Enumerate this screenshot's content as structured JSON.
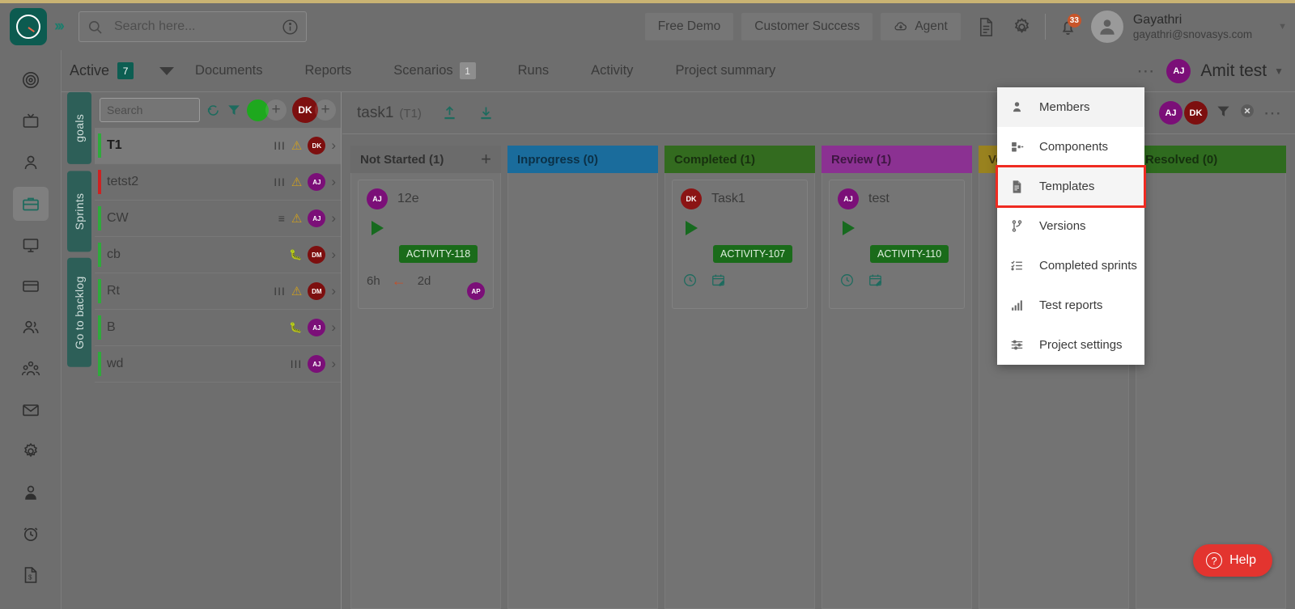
{
  "header": {
    "logo_icon": "speedometer-logo-icon",
    "expand_icon": "chevron-double-right-icon",
    "search": {
      "placeholder": "Search here...",
      "value": "",
      "icon": "search-icon",
      "info_icon": "info-circle-icon"
    },
    "buttons": [
      {
        "label": "Free Demo",
        "name": "free-demo-button"
      },
      {
        "label": "Customer Success",
        "name": "customer-success-button"
      },
      {
        "label": "Agent",
        "name": "agent-button",
        "icon": "cloud-download-icon"
      }
    ],
    "doc_icon": "document-icon",
    "settings_icon": "gear-icon",
    "notification_icon": "bell-icon",
    "notification_count": "33",
    "user": {
      "name": "Gayathri",
      "email": "gayathri@snovasys.com",
      "avatar_icon": "user-avatar-icon"
    },
    "user_caret_icon": "chevron-down-icon"
  },
  "rail": {
    "items": [
      {
        "name": "sidebar-item-goals",
        "icon": "target-icon"
      },
      {
        "name": "sidebar-item-presentation",
        "icon": "tv-icon"
      },
      {
        "name": "sidebar-item-profile",
        "icon": "person-icon"
      },
      {
        "name": "sidebar-item-projects",
        "icon": "briefcase-icon",
        "active": true
      },
      {
        "name": "sidebar-item-desktop",
        "icon": "monitor-icon"
      },
      {
        "name": "sidebar-item-billing",
        "icon": "card-icon"
      },
      {
        "name": "sidebar-item-teams",
        "icon": "people-icon"
      },
      {
        "name": "sidebar-item-organization",
        "icon": "group-icon"
      },
      {
        "name": "sidebar-item-mail",
        "icon": "envelope-icon"
      },
      {
        "name": "sidebar-item-settings",
        "icon": "gear-icon"
      },
      {
        "name": "sidebar-item-user",
        "icon": "user-circle-icon"
      },
      {
        "name": "sidebar-item-timesheet",
        "icon": "alarm-clock-icon"
      },
      {
        "name": "sidebar-item-invoice",
        "icon": "invoice-icon"
      }
    ]
  },
  "tabbar": {
    "active_filter": {
      "label": "Active",
      "count": "7"
    },
    "dropdown_icon": "triangle-down-icon",
    "tabs": [
      {
        "label": "Documents",
        "count": ""
      },
      {
        "label": "Reports",
        "count": ""
      },
      {
        "label": "Scenarios",
        "count": "1"
      },
      {
        "label": "Runs",
        "count": ""
      },
      {
        "label": "Activity",
        "count": ""
      },
      {
        "label": "Project summary",
        "count": ""
      }
    ],
    "more_icon": "ellipsis-icon",
    "project": {
      "initials": "AJ",
      "name": "Amit test",
      "color": "#7b0f78"
    },
    "project_caret_icon": "chevron-down-icon"
  },
  "vertical_tabs": [
    {
      "label": "goals",
      "icon": "pin-icon"
    },
    {
      "label": "Sprints",
      "icon": "pin-icon"
    },
    {
      "label": "Go to backlog",
      "icon": "arrow-up-icon"
    }
  ],
  "list_panel": {
    "search_placeholder": "Search",
    "search_value": "",
    "refresh_icon": "refresh-icon",
    "filter_icon": "filter-icon",
    "status_dot_color": "#1ea81e",
    "add_icon": "plus-icon",
    "owner_avatar": {
      "initials": "DK",
      "color": "#7d0f0f"
    },
    "add_member_icon": "plus-icon",
    "rows": [
      {
        "name": "T1",
        "bar": "#2faa3c",
        "selected": true,
        "priority": "III",
        "warn": true,
        "bug": false,
        "avatar": {
          "initials": "DK",
          "color": "#7d0f0f"
        }
      },
      {
        "name": "tetst2",
        "bar": "#cc2222",
        "selected": false,
        "priority": "III",
        "warn": true,
        "bug": false,
        "avatar": {
          "initials": "AJ",
          "color": "#7b0f78"
        }
      },
      {
        "name": "CW",
        "bar": "#2faa3c",
        "selected": false,
        "priority": "≡",
        "warn": true,
        "bug": false,
        "avatar": {
          "initials": "AJ",
          "color": "#7b0f78"
        }
      },
      {
        "name": "cb",
        "bar": "#2faa3c",
        "selected": false,
        "priority": "",
        "warn": false,
        "bug": true,
        "avatar": {
          "initials": "DM",
          "color": "#7d0f0f"
        }
      },
      {
        "name": "Rt",
        "bar": "#2faa3c",
        "selected": false,
        "priority": "III",
        "warn": true,
        "bug": false,
        "avatar": {
          "initials": "DM",
          "color": "#7d0f0f"
        }
      },
      {
        "name": "B",
        "bar": "#2faa3c",
        "selected": false,
        "priority": "",
        "warn": false,
        "bug": true,
        "avatar": {
          "initials": "AJ",
          "color": "#7b0f78"
        }
      },
      {
        "name": "wd",
        "bar": "#2faa3c",
        "selected": false,
        "priority": "III",
        "warn": false,
        "bug": false,
        "avatar": {
          "initials": "AJ",
          "color": "#7b0f78"
        }
      }
    ]
  },
  "board": {
    "title": "task1",
    "title_key": "(T1)",
    "upload_icon": "upload-icon",
    "download_icon": "download-icon",
    "toolbar_avatars": [
      {
        "initials": "AJ",
        "color": "#7b0f78"
      },
      {
        "initials": "DK",
        "color": "#7d0f0f"
      }
    ],
    "filter_icon": "filter-icon",
    "clear_icon": "close-circle-icon",
    "more_icon": "ellipsis-icon",
    "columns": [
      {
        "title": "Not Started (1)",
        "color": "#6b6b6b",
        "add_icon": "plus-icon",
        "cards": [
          {
            "avatar": {
              "initials": "AJ",
              "color": "#7b0f78"
            },
            "title": "12e",
            "play_icon": "play-icon",
            "tag": "ACTIVITY-118",
            "estimate": "6h",
            "arrow_icon": "arrow-left-icon",
            "spent": "2d",
            "assignee": {
              "initials": "AP",
              "color": "#7b0f78"
            }
          }
        ]
      },
      {
        "title": "Inprogress (0)",
        "color": "#1a6c9c",
        "cards": []
      },
      {
        "title": "Completed (1)",
        "color": "#336b1f",
        "cards": [
          {
            "avatar": {
              "initials": "DK",
              "color": "#8b1414"
            },
            "title": "Task1",
            "play_icon": "play-icon",
            "tag": "ACTIVITY-107",
            "clock_icon": "clock-icon",
            "calendar_icon": "calendar-edit-icon"
          }
        ]
      },
      {
        "title": "Review (1)",
        "color": "#8b3192",
        "cards": [
          {
            "avatar": {
              "initials": "AJ",
              "color": "#7b0f78"
            },
            "title": "test",
            "play_icon": "play-icon",
            "tag": "ACTIVITY-110",
            "clock_icon": "clock-icon",
            "calendar_icon": "calendar-edit-icon"
          }
        ]
      },
      {
        "title": "Verified (0)",
        "color": "#99821f",
        "cards": []
      },
      {
        "title": "Resolved (0)",
        "color": "#2f6b1f",
        "cards": []
      }
    ]
  },
  "menu": {
    "items": [
      {
        "label": "Members",
        "icon": "person-icon",
        "name": "menu-item-members"
      },
      {
        "label": "Components",
        "icon": "component-icon",
        "name": "menu-item-components"
      },
      {
        "label": "Templates",
        "icon": "template-doc-icon",
        "name": "menu-item-templates",
        "highlighted": true
      },
      {
        "label": "Versions",
        "icon": "branch-icon",
        "name": "menu-item-versions"
      },
      {
        "label": "Completed sprints",
        "icon": "checklist-icon",
        "name": "menu-item-completed-sprints"
      },
      {
        "label": "Test reports",
        "icon": "bar-chart-icon",
        "name": "menu-item-test-reports"
      },
      {
        "label": "Project settings",
        "icon": "sliders-icon",
        "name": "menu-item-project-settings"
      }
    ],
    "highlight_color": "#ef2b21"
  },
  "help": {
    "label": "Help",
    "icon": "question-circle-icon",
    "color": "#e3342f"
  }
}
